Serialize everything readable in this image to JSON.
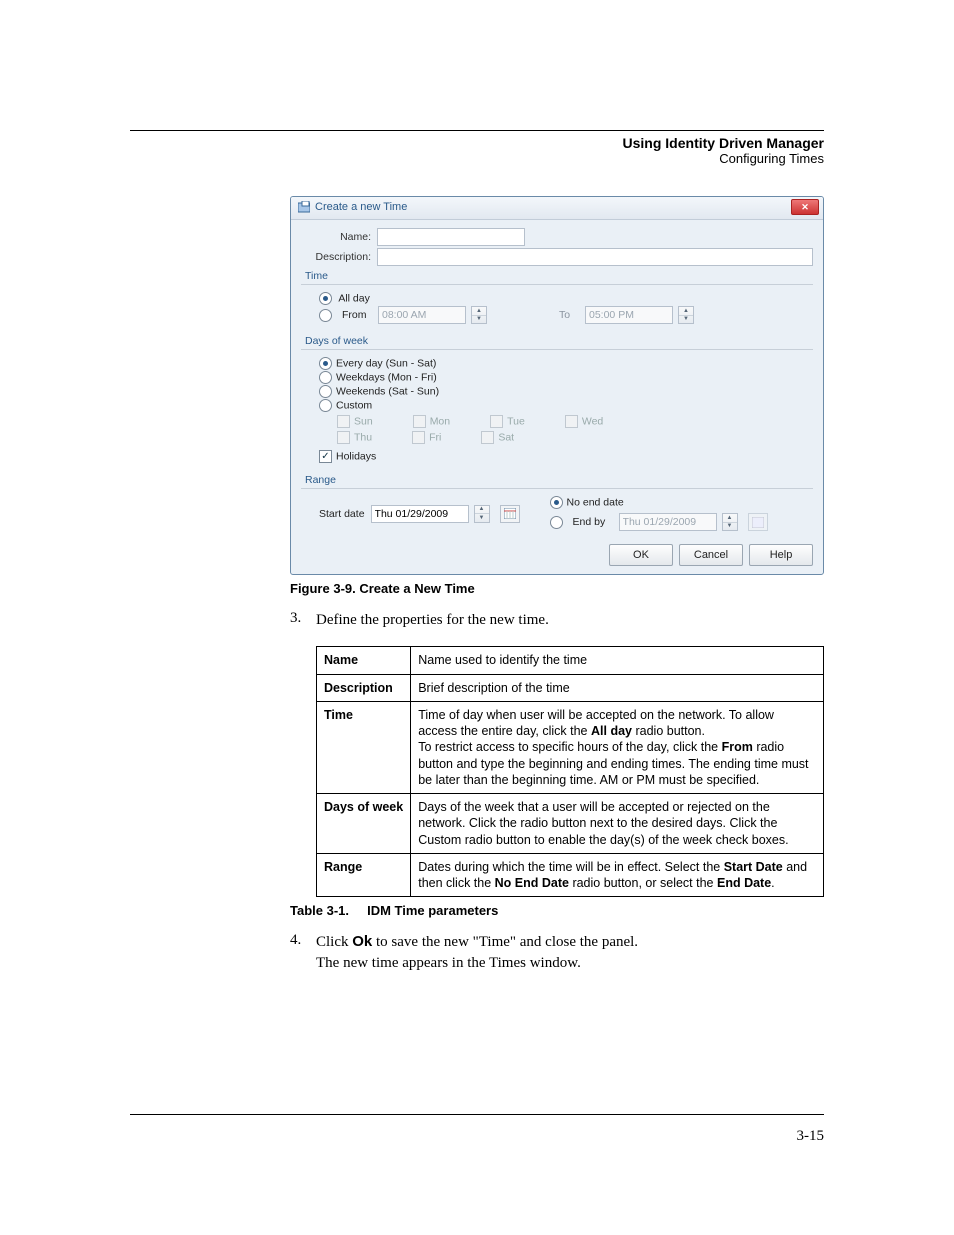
{
  "header": {
    "title": "Using Identity Driven Manager",
    "subtitle": "Configuring Times"
  },
  "dialog": {
    "title": "Create a new Time",
    "labels": {
      "name": "Name:",
      "description": "Description:",
      "time_section": "Time",
      "all_day": "All day",
      "from": "From",
      "from_value": "08:00 AM",
      "to": "To",
      "to_value": "05:00 PM",
      "days_section": "Days of week",
      "every_day": "Every day (Sun - Sat)",
      "weekdays": "Weekdays (Mon - Fri)",
      "weekends": "Weekends (Sat - Sun)",
      "custom": "Custom",
      "sun": "Sun",
      "mon": "Mon",
      "tue": "Tue",
      "wed": "Wed",
      "thu": "Thu",
      "fri": "Fri",
      "sat": "Sat",
      "holidays": "Holidays",
      "range_section": "Range",
      "start_date": "Start date",
      "start_value": "Thu 01/29/2009",
      "no_end": "No end date",
      "end_by": "End by",
      "end_value": "Thu 01/29/2009",
      "ok": "OK",
      "cancel": "Cancel",
      "help": "Help"
    }
  },
  "figure_caption": "Figure 3-9. Create a New Time",
  "step3": {
    "num": "3.",
    "text": "Define the properties for the new time."
  },
  "table": {
    "rows": [
      {
        "name": "Name",
        "desc": "Name used to identify the time"
      },
      {
        "name": "Description",
        "desc": "Brief description of the time"
      },
      {
        "name": "Time",
        "desc_html": "Time of day when user will be accepted on the network. To allow access the entire day, click the <b>All day</b> radio button.<br>To restrict access to specific hours of the day, click the <b>From</b> radio button and type the beginning and ending times. The ending time must be later than the beginning time. AM or PM must be specified."
      },
      {
        "name": "Days of week",
        "desc": "Days of the week that a user will be accepted or rejected on the network. Click the radio button next to the desired days. Click the Custom radio button to enable the day(s) of the week check boxes."
      },
      {
        "name": "Range",
        "desc_html": "Dates during which the time will be in effect. Select the <b>Start Date</b> and then click the <b>No End Date</b> radio button, or select the <b>End Date</b>."
      }
    ]
  },
  "table_caption": {
    "num": "Table 3-1.",
    "title": "IDM Time parameters"
  },
  "step4": {
    "num": "4.",
    "line1_pre": "Click ",
    "line1_bold": "Ok",
    "line1_post": " to save the new \"Time\" and close the panel.",
    "line2": "The new time appears in the Times window."
  },
  "page_number": "3-15"
}
